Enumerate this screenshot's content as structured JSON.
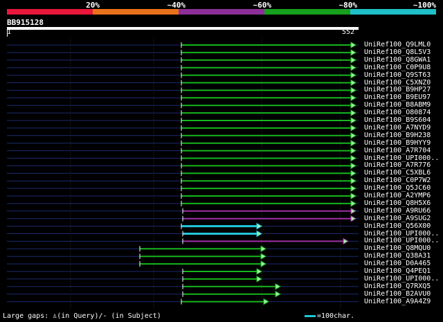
{
  "legend": {
    "labels": [
      "20%",
      "~40%",
      "~60%",
      "~80%",
      "~100%"
    ],
    "colors": [
      "#e8173b",
      "#e8721a",
      "#8c2f98",
      "#16a01e",
      "#1fc0c8"
    ]
  },
  "query": {
    "name": "BB915128",
    "start": "1",
    "end": "552"
  },
  "colors": {
    "green": "#16b81e",
    "purple": "#a030a8",
    "cyan": "#20c8dc",
    "background_line": "#1c2a6e",
    "grid": "#303030",
    "arrow_fill": "#a0f0a0"
  },
  "hits": [
    {
      "name": "UniRef100_Q9LML0",
      "color": "green"
    },
    {
      "name": "UniRef100_Q8L5V3",
      "color": "green"
    },
    {
      "name": "UniRef100_Q8GWA1",
      "color": "green"
    },
    {
      "name": "UniRef100_C0P9U8",
      "color": "green"
    },
    {
      "name": "UniRef100_Q9ST63",
      "color": "green"
    },
    {
      "name": "UniRef100_C5XNZ0",
      "color": "green"
    },
    {
      "name": "UniRef100_B9HP27",
      "color": "green"
    },
    {
      "name": "UniRef100_B9EU97",
      "color": "green"
    },
    {
      "name": "UniRef100_B8ABM9",
      "color": "green"
    },
    {
      "name": "UniRef100_O80874",
      "color": "green"
    },
    {
      "name": "UniRef100_B9S604",
      "color": "green"
    },
    {
      "name": "UniRef100_A7NYD9",
      "color": "green"
    },
    {
      "name": "UniRef100_B9H238",
      "color": "green"
    },
    {
      "name": "UniRef100_B9HYY9",
      "color": "green"
    },
    {
      "name": "UniRef100_A7R704",
      "color": "green"
    },
    {
      "name": "UniRef100_UPI000..",
      "color": "green"
    },
    {
      "name": "UniRef100_A7R776",
      "color": "green"
    },
    {
      "name": "UniRef100_C5XBL6",
      "color": "green"
    },
    {
      "name": "UniRef100_C0P7W2",
      "color": "green"
    },
    {
      "name": "UniRef100_Q5JC60",
      "color": "green"
    },
    {
      "name": "UniRef100_A2YMP6",
      "color": "green"
    },
    {
      "name": "UniRef100_Q8H5X6",
      "color": "green"
    },
    {
      "name": "UniRef100_A9RU66",
      "color": "purple"
    },
    {
      "name": "UniRef100_A9SUG2",
      "color": "purple"
    },
    {
      "name": "UniRef100_Q56X00",
      "color": "cyan"
    },
    {
      "name": "UniRef100_UPI000..",
      "color": "cyan"
    },
    {
      "name": "UniRef100_UPI000..",
      "color": "purple"
    },
    {
      "name": "UniRef100_Q8MQU0",
      "color": "green"
    },
    {
      "name": "UniRef100_Q38A31",
      "color": "green"
    },
    {
      "name": "UniRef100_D0A465",
      "color": "green"
    },
    {
      "name": "UniRef100_Q4PEQ1",
      "color": "green"
    },
    {
      "name": "UniRef100_UPI000..",
      "color": "green"
    },
    {
      "name": "UniRef100_Q7RXQ5",
      "color": "green"
    },
    {
      "name": "UniRef100_B2AVU0",
      "color": "green"
    },
    {
      "name": "UniRef100_A9A4Z9",
      "color": "green"
    }
  ],
  "footer": {
    "large_gaps": "Large gaps: ♙(in Query)/- (in Subject)",
    "scale": "=100char."
  }
}
